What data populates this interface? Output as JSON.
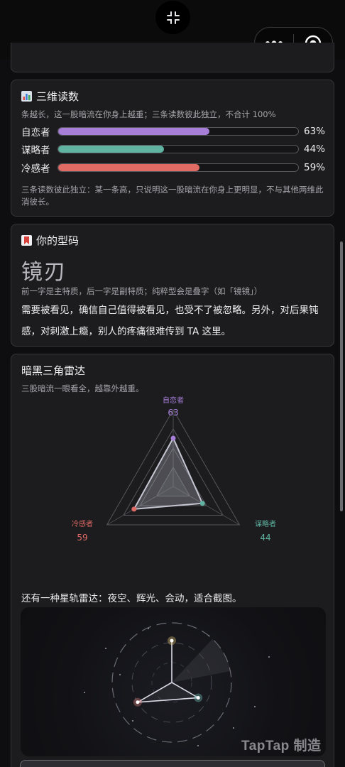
{
  "stats_card": {
    "title": "三维读数",
    "subtitle": "条越长，这一股暗流在你身上越重；三条读数彼此独立，不合计 100%",
    "bars": [
      {
        "label": "自恋者",
        "value": 63,
        "value_text": "63%",
        "color": "#a77fd9"
      },
      {
        "label": "谋略者",
        "value": 44,
        "value_text": "44%",
        "color": "#5fb3a0"
      },
      {
        "label": "冷感者",
        "value": 59,
        "value_text": "59%",
        "color": "#e06a64"
      }
    ],
    "note": "三条读数彼此独立：某一条高，只说明这一股暗流在你身上更明显，不与其他两维此消彼长。"
  },
  "type_card": {
    "title": "你的型码",
    "type_code": "镜刃",
    "hint": "前一字是主特质，后一字是副特质；纯粹型会是叠字（如「镜镜」）",
    "description": "需要被看见，确信自己值得被看见，也受不了被忽略。另外，对后果钝感，对刺激上瘾，别人的疼痛很难传到 TA 这里。"
  },
  "radar_card": {
    "title": "暗黑三角雷达",
    "subtitle": "三股暗流一眼看全，越靠外越重。",
    "axes": [
      {
        "label": "自恋者",
        "value": 63,
        "value_text": "63",
        "color": "#a77fd9"
      },
      {
        "label": "谋略者",
        "value": 44,
        "value_text": "44",
        "color": "#5fb3a0"
      },
      {
        "label": "冷感者",
        "value": 59,
        "value_text": "59",
        "color": "#e06a64"
      }
    ],
    "star_intro": "还有一种星轨雷达：夜空、辉光、会动，适合截图。"
  },
  "watermark": "TapTap 制造",
  "icons": {
    "collapse": "collapse-arrows-icon",
    "more": "more-dots-icon",
    "close": "target-circle-icon",
    "chart": "bar-chart-icon",
    "bookmark": "bookmark-icon"
  }
}
